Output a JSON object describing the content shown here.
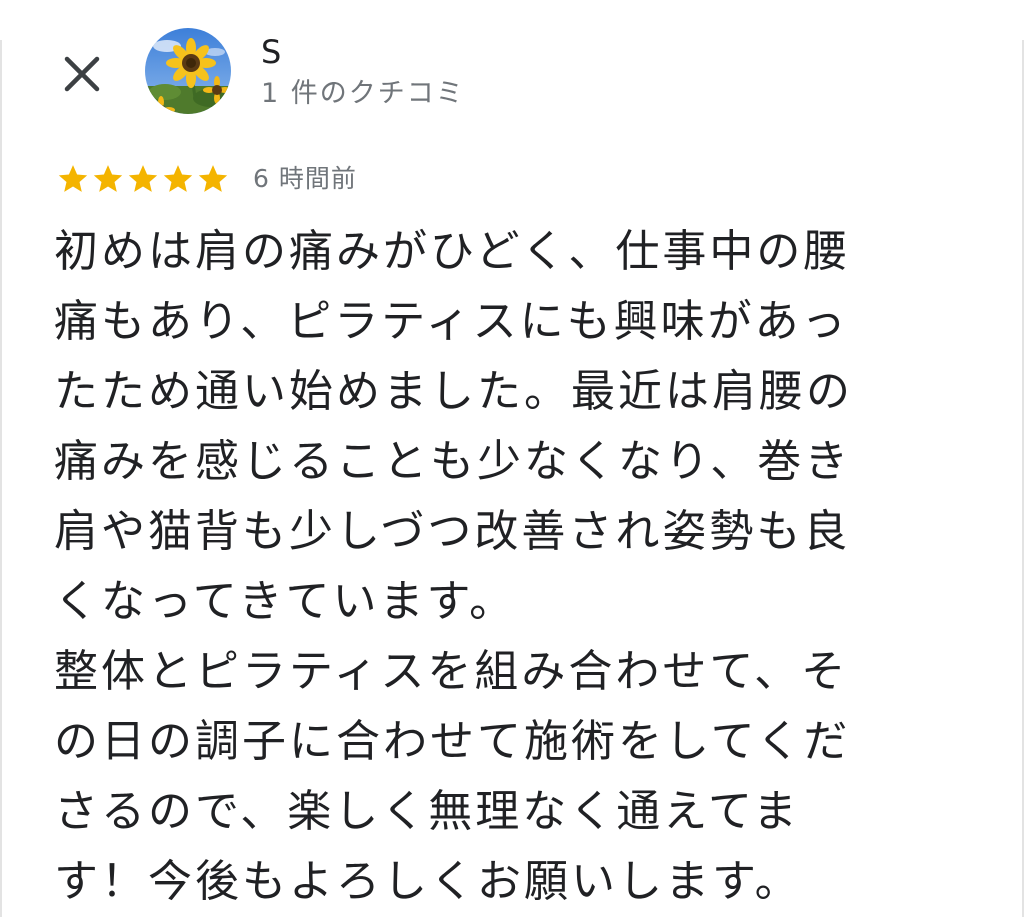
{
  "header": {
    "close_icon": "close-icon",
    "avatar_icon": "sunflower-avatar",
    "reviewer_name": "S",
    "review_count": "1 件のクチコミ"
  },
  "review": {
    "rating": 5,
    "rating_max": 5,
    "star_color": "#f4b400",
    "time_ago": "6 時間前",
    "text": "初めは肩の痛みがひどく、仕事中の腰\n痛もあり、ピラティスにも興味があっ\nたため通い始めました。最近は肩腰の\n痛みを感じることも少なくなり、巻き\n肩や猫背も少しづつ改善され姿勢も良\nくなってきています。\n整体とピラティスを組み合わせて、そ\nの日の調子に合わせて施術をしてくだ\nさるので、楽しく無理なく通えてま\nす！今後もよろしくお願いします。"
  }
}
